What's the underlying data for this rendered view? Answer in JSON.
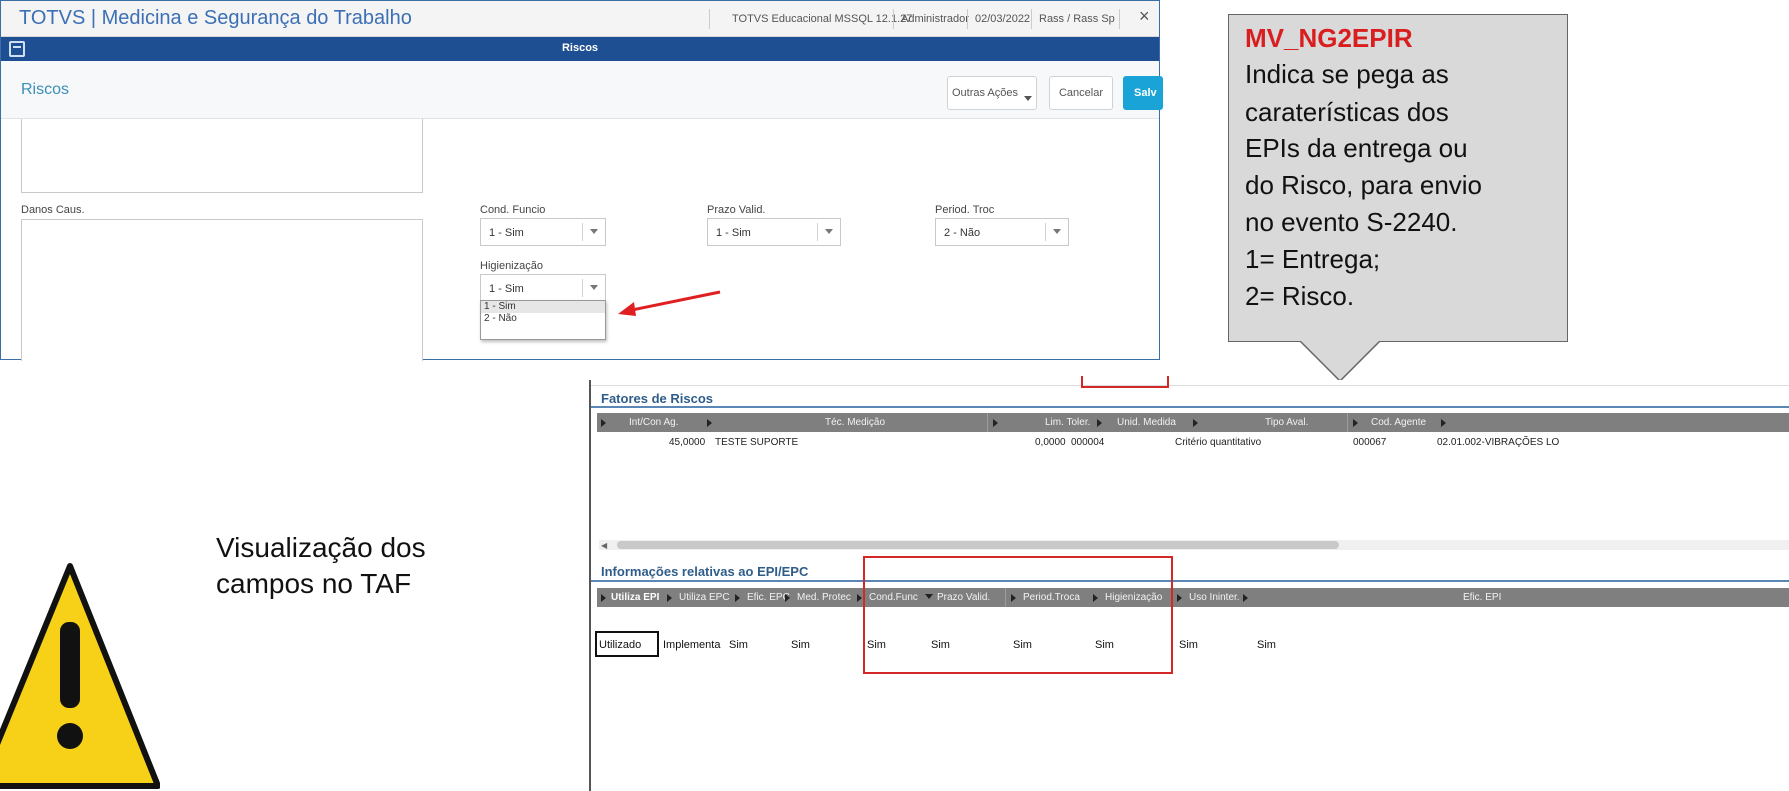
{
  "app": {
    "title": "TOTVS | Medicina e Segurança do Trabalho",
    "env": "TOTVS Educacional MSSQL 12.1.27",
    "user": "Administrador",
    "date": "02/03/2022",
    "branch": "Rass / Rass Sp",
    "close": "×",
    "window_title": "Riscos",
    "page_title": "Riscos"
  },
  "actions": {
    "outras": "Outras Ações",
    "cancelar": "Cancelar",
    "salvar": "Salv"
  },
  "form": {
    "danos_label": "Danos Caus.",
    "cond_funcio": {
      "label": "Cond. Funcio",
      "value": "1 - Sim"
    },
    "prazo_valid": {
      "label": "Prazo Valid.",
      "value": "1 - Sim"
    },
    "period_troc": {
      "label": "Period. Troc",
      "value": "2 - Não"
    },
    "higienizacao": {
      "label": "Higienização",
      "value": "1 - Sim",
      "options": [
        "1 - Sim",
        "2 - Não"
      ]
    }
  },
  "callout": {
    "title": "MV_NG2EPIR",
    "lines": [
      "Indica se pega as",
      "caraterísticas dos",
      "EPIs da entrega ou",
      "do Risco, para envio",
      "no evento S-2240.",
      "1= Entrega;",
      "2= Risco."
    ]
  },
  "fatores": {
    "title": "Fatores de Riscos",
    "columns": [
      "Int/Con Ag.",
      "Téc. Medição",
      "Lim. Toler.",
      "Unid. Medida",
      "Tipo Aval.",
      "Cod. Agente"
    ],
    "row": {
      "int_con": "45,0000",
      "tec_medicao": "TESTE SUPORTE",
      "lim_toler": "0,0000",
      "unid_medida": "000004",
      "tipo_aval": "Critério quantitativo",
      "cod_agente": "000067",
      "agente_desc": "02.01.002-VIBRAÇÕES LO"
    }
  },
  "epi": {
    "title": "Informações relativas ao EPI/EPC",
    "columns": [
      "Utiliza EPI",
      "Utiliza EPC",
      "Efic. EPC",
      "Med. Protec",
      "Cond.Func",
      "Prazo Valid.",
      "Period.Troca",
      "Higienização",
      "Uso Ininter.",
      "Efic. EPI"
    ],
    "row": [
      "Utilizado",
      "Implementa",
      "Sim",
      "Sim",
      "Sim",
      "Sim",
      "Sim",
      "Sim",
      "Sim",
      "Sim"
    ]
  },
  "note": {
    "line1": "Visualização dos",
    "line2": "campos no TAF"
  },
  "colors": {
    "accent_blue": "#1e4f92",
    "callout_title": "#d81e1e",
    "highlight_red": "#d42828",
    "warning_yellow": "#f7d117"
  }
}
